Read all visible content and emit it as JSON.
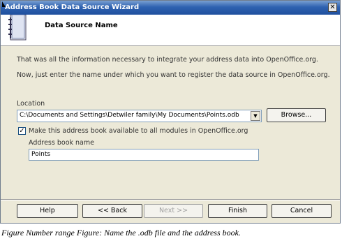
{
  "window": {
    "title": "Address Book Data Source Wizard",
    "close_glyph": "✕"
  },
  "header": {
    "title": "Data Source Name",
    "icon": "address-book-icon"
  },
  "content": {
    "intro_line_1": "That was all the information necessary to integrate your address data into OpenOffice.org.",
    "intro_line_2": "Now, just enter the name under which you want to register the data source in OpenOffice.org.",
    "location_label": "Location",
    "location_value": "C:\\Documents and Settings\\Detwiler family\\My Documents\\Points.odb",
    "browse_label": "Browse...",
    "make_available_label": "Make this address book available to all modules in OpenOffice.org",
    "make_available_checked": true,
    "address_book_name_label": "Address book name",
    "address_book_name_value": "Points"
  },
  "footer": {
    "help_label": "Help",
    "back_label": "<< Back",
    "next_label": "Next >>",
    "finish_label": "Finish",
    "cancel_label": "Cancel"
  },
  "caption": "Figure Number range Figure: Name the .odb file and the address book.",
  "colors": {
    "titlebar": "#2f62b0",
    "dialog_bg": "#ece9d8",
    "field_border": "#7f9db9"
  }
}
